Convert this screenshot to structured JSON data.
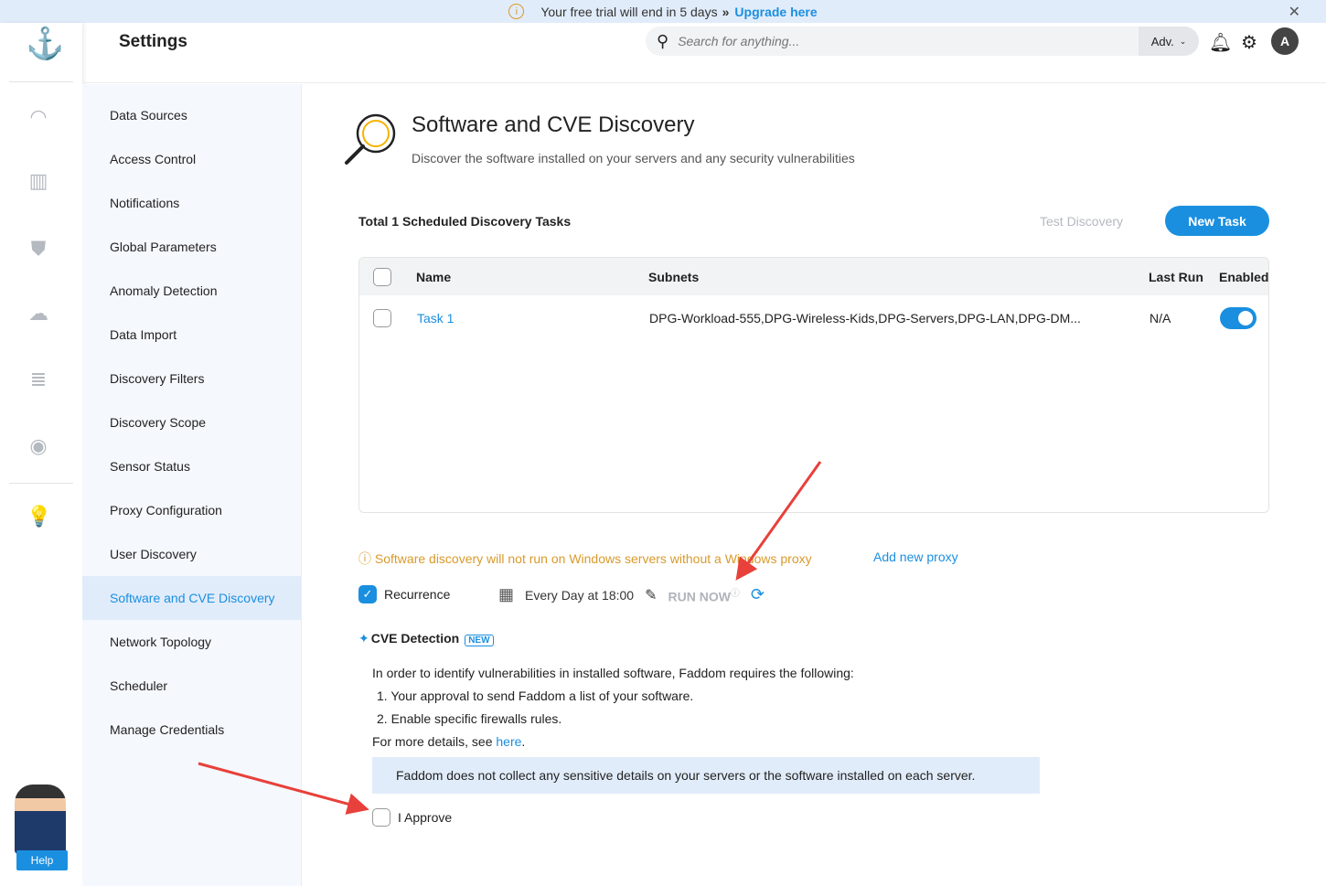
{
  "banner": {
    "text": "Your free trial will end in 5 days",
    "chevrons": "»",
    "link": "Upgrade here"
  },
  "header": {
    "title": "Settings",
    "search_placeholder": "Search for anything...",
    "adv_label": "Adv.",
    "user_initial": "A"
  },
  "rail": {
    "icons": [
      "dashboard-icon",
      "map-icon",
      "shield-icon",
      "cloud-icon",
      "database-icon",
      "compass-icon",
      "lightbulb-icon"
    ],
    "help_label": "Help"
  },
  "sidebar": {
    "items": [
      {
        "label": "Data Sources"
      },
      {
        "label": "Access Control"
      },
      {
        "label": "Notifications"
      },
      {
        "label": "Global Parameters"
      },
      {
        "label": "Anomaly Detection"
      },
      {
        "label": "Data Import"
      },
      {
        "label": "Discovery Filters"
      },
      {
        "label": "Discovery Scope"
      },
      {
        "label": "Sensor Status"
      },
      {
        "label": "Proxy Configuration"
      },
      {
        "label": "User Discovery"
      },
      {
        "label": "Software and CVE Discovery",
        "active": true
      },
      {
        "label": "Network Topology"
      },
      {
        "label": "Scheduler"
      },
      {
        "label": "Manage Credentials"
      }
    ]
  },
  "main": {
    "title": "Software and CVE Discovery",
    "subtitle": "Discover the software installed on your servers and any security vulnerabilities",
    "total": "Total 1 Scheduled Discovery Tasks",
    "test_discovery": "Test Discovery",
    "new_task": "New Task",
    "table": {
      "columns": [
        "Name",
        "Subnets",
        "Last Run",
        "Enabled"
      ],
      "rows": [
        {
          "name": "Task 1",
          "subnets": "DPG-Workload-555,DPG-Wireless-Kids,DPG-Servers,DPG-LAN,DPG-DM...",
          "last_run": "N/A",
          "enabled": true
        }
      ]
    },
    "warning": "Software discovery will not run on Windows servers without a Windows proxy",
    "add_proxy": "Add new proxy",
    "recurrence_label": "Recurrence",
    "recurrence_checked": true,
    "schedule": "Every Day at 18:00",
    "run_now": "RUN NOW",
    "cve": {
      "title": "CVE Detection",
      "badge": "NEW",
      "intro": "In order to identify vulnerabilities in installed software, Faddom requires the following:",
      "req1": "1. Your approval to send Faddom a list of your software.",
      "req2": "2. Enable specific firewalls rules.",
      "more_prefix": "For more details, see ",
      "more_link": "here",
      "more_suffix": ".",
      "notice": "Faddom does not collect any sensitive details on your servers or the software installed on each server.",
      "approve_label": "I Approve",
      "approved": false
    }
  },
  "colors": {
    "accent": "#1a8fe0",
    "warning": "#d99a2b",
    "annotation": "#e8403a"
  }
}
